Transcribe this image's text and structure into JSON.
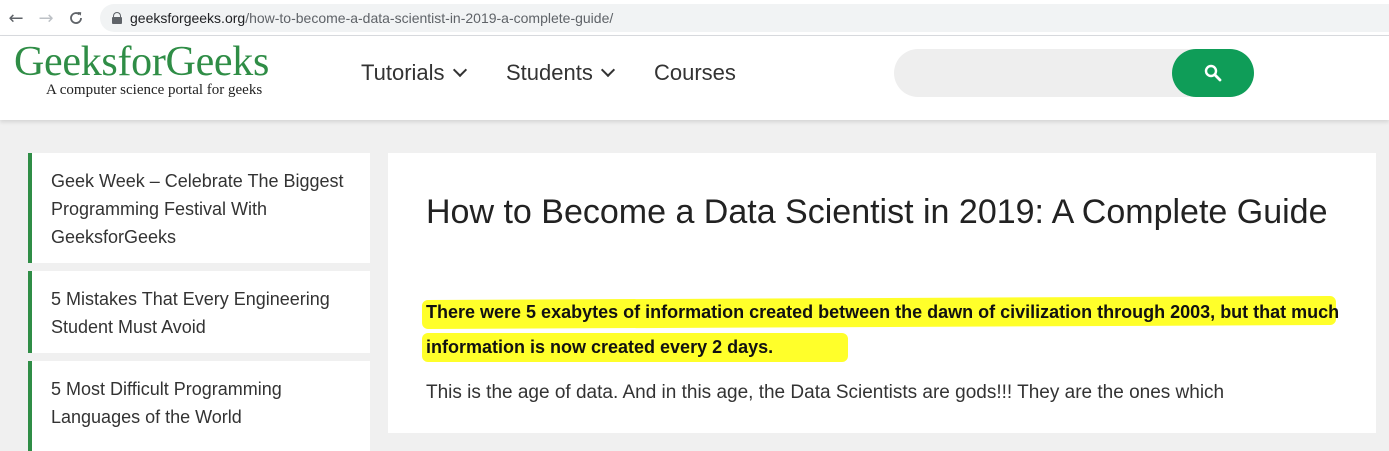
{
  "browser": {
    "back_icon": "arrow-left-icon",
    "forward_icon": "arrow-right-icon",
    "reload_icon": "reload-icon",
    "lock_icon": "lock-icon",
    "url_domain": "geeksforgeeks.org",
    "url_path": "/how-to-become-a-data-scientist-in-2019-a-complete-guide/"
  },
  "header": {
    "logo_title": "GeeksforGeeks",
    "logo_tagline": "A computer science portal for geeks",
    "brand_color": "#2f8d46",
    "menu": [
      {
        "label": "Tutorials",
        "has_dropdown": true
      },
      {
        "label": "Students",
        "has_dropdown": true
      },
      {
        "label": "Courses",
        "has_dropdown": false
      }
    ],
    "search": {
      "placeholder": "",
      "button_icon": "search-icon",
      "button_color": "#0f9d58"
    }
  },
  "sidebar": {
    "items": [
      {
        "label": "Geek Week – Celebrate The Biggest Programming Festival With GeeksforGeeks"
      },
      {
        "label": "5 Mistakes That Every Engineering Student Must Avoid"
      },
      {
        "label": "5 Most Difficult Programming Languages of the World"
      }
    ]
  },
  "article": {
    "title": "How to Become a Data Scientist in 2019: A Complete Guide",
    "highlight": "There were 5 exabytes of information created between the dawn of civilization through 2003, but that much information is now created every 2 days.",
    "highlight_color": "#ffff2a",
    "body": "This is the age of data. And in this age, the Data Scientists are gods!!! They are the ones which"
  }
}
